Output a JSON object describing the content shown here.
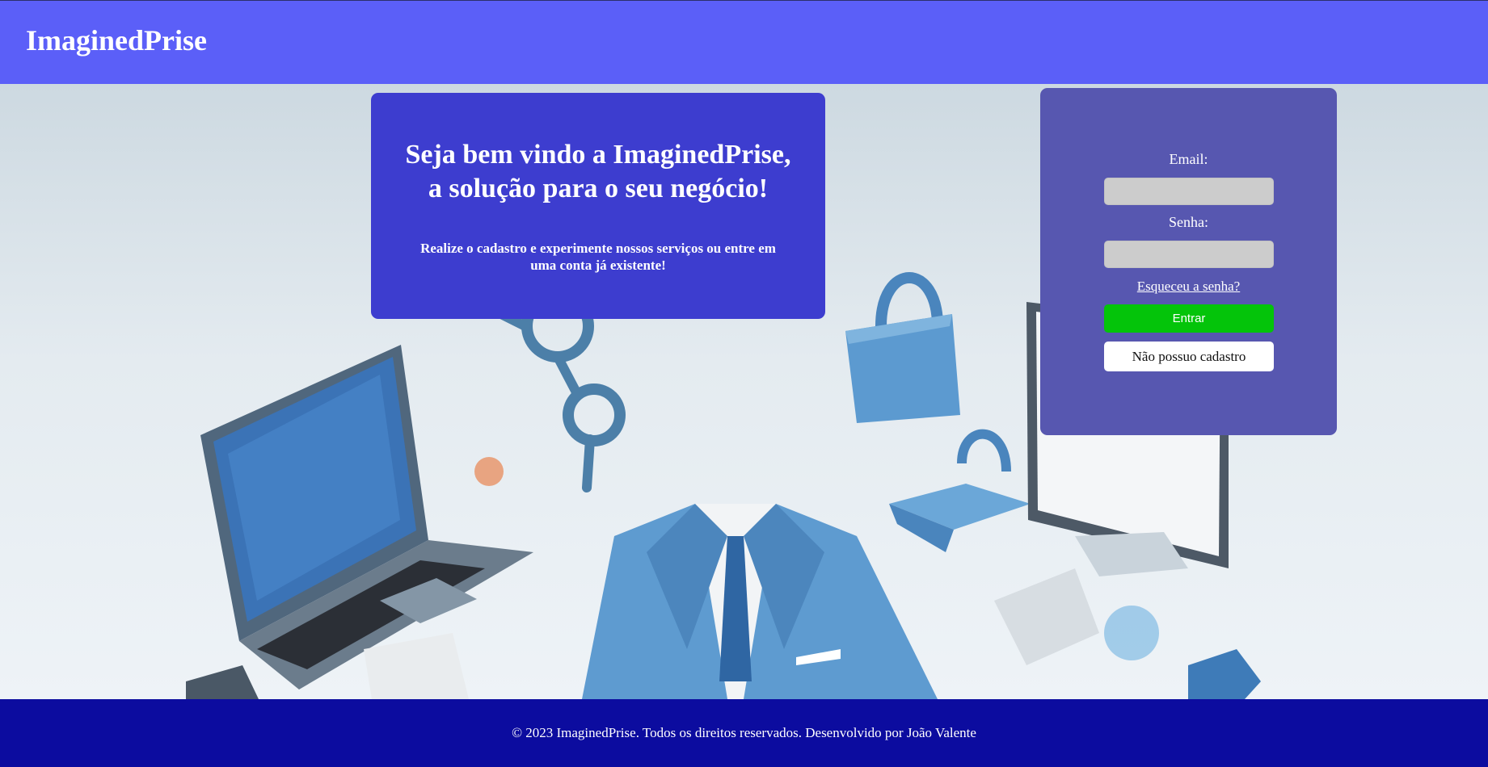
{
  "header": {
    "brand": "ImaginedPrise"
  },
  "welcome": {
    "title": "Seja bem vindo a ImaginedPrise, a solução para o seu negócio!",
    "subtitle": "Realize o cadastro e experimente nossos serviços ou entre em uma conta já existente!"
  },
  "login": {
    "email_label": "Email:",
    "email_value": "",
    "password_label": "Senha:",
    "password_value": "",
    "forgot_link": "Esqueceu a senha?",
    "enter_button": "Entrar",
    "register_button": "Não possuo cadastro"
  },
  "footer": {
    "copyright": "© 2023 ImaginedPrise. Todos os direitos reservados. Desenvolvido por João Valente"
  },
  "colors": {
    "header_bg": "#5b5ff8",
    "welcome_bg": "#3d3dcf",
    "login_bg": "#5757b0",
    "enter_button": "#04c40a",
    "footer_bg": "#0c0c9f"
  }
}
